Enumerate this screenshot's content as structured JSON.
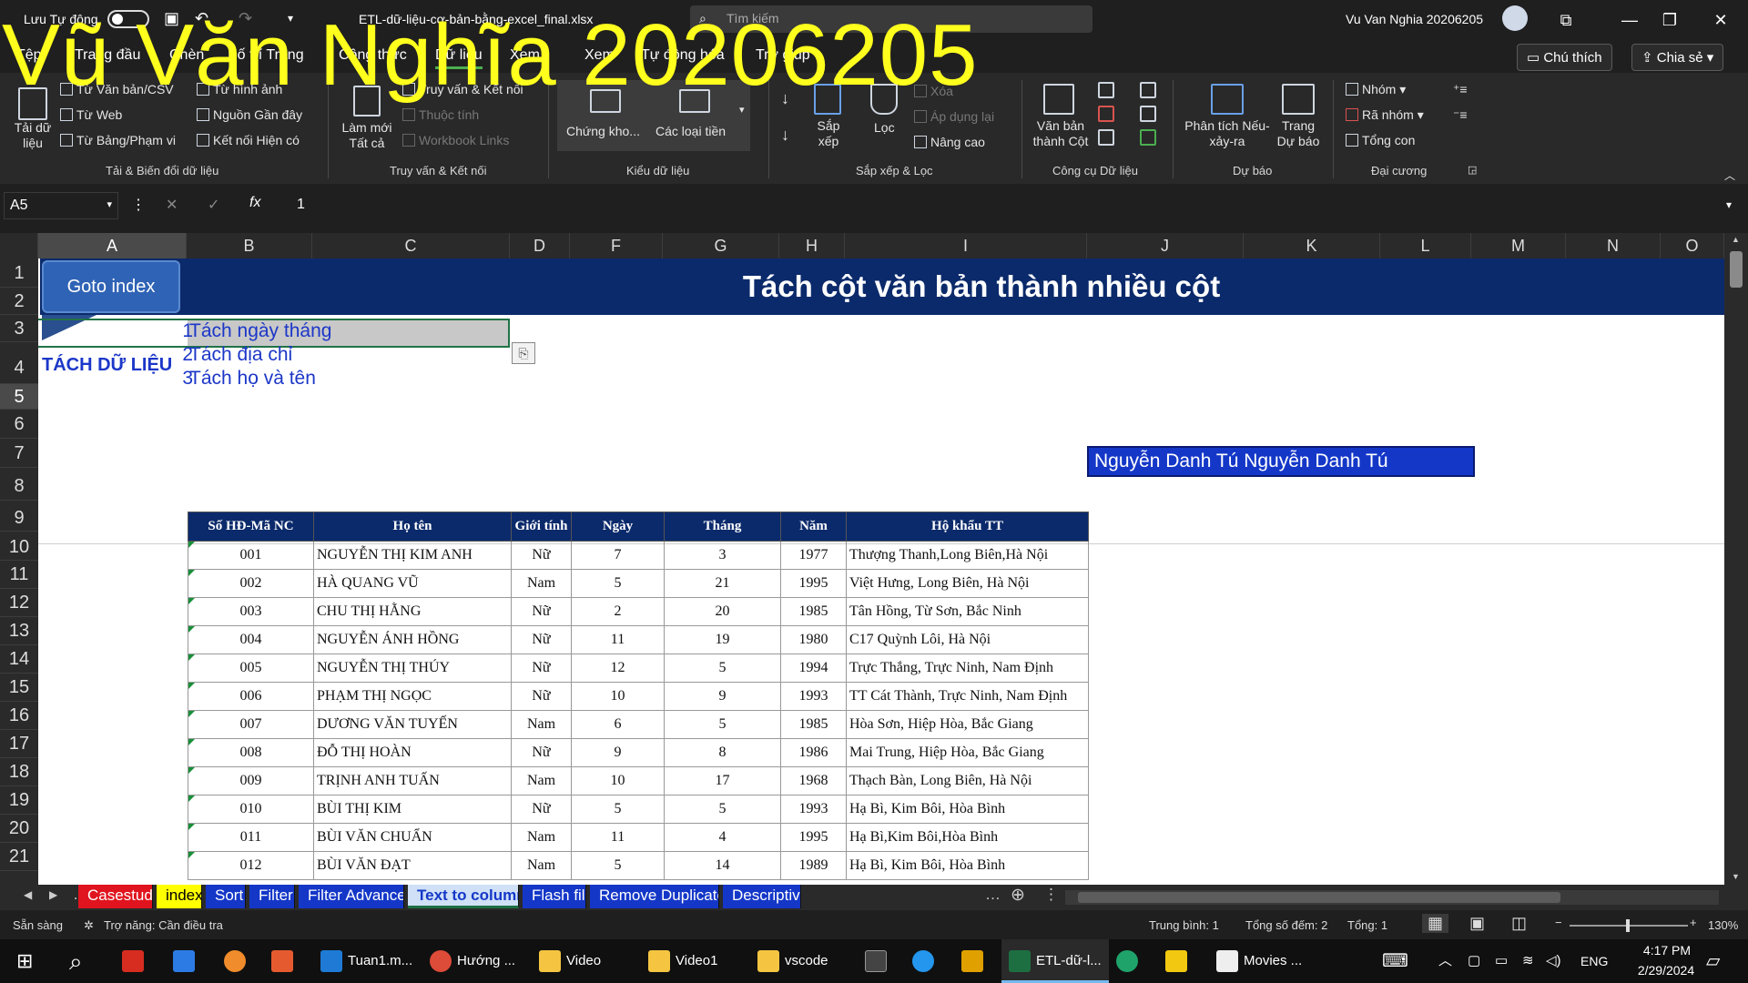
{
  "titlebar": {
    "autosave_label": "Lưu Tự động",
    "filename": "ETL-dữ-liệu-cơ-bản-bằng-excel_final.xlsx",
    "search_placeholder": "Tìm kiếm",
    "user_name": "Vu Van Nghia 20206205"
  },
  "watermark": "Vũ Văn Nghĩa 20206205",
  "tabs": [
    "Tệp",
    "Trang đầu",
    "Chèn",
    "Bố trí Trang",
    "Công thức",
    "Dữ liệu",
    "Xem",
    "Xem",
    "Tự động hóa",
    "Trợ giúp"
  ],
  "top_buttons": {
    "comments": "Chú thích",
    "share": "Chia sẻ"
  },
  "ribbon": {
    "get_data": "Tải dữ liệu",
    "from_text": "Từ Văn bản/CSV",
    "from_web": "Từ Web",
    "from_table": "Từ Bảng/Phạm vi",
    "from_picture": "Từ hình ảnh",
    "recent_sources": "Nguồn Gần đây",
    "existing_conn": "Kết nối Hiện có",
    "group_get": "Tải & Biến đổi dữ liệu",
    "refresh_all": "Làm mới Tất cả",
    "queries_conn": "Truy vấn & Kết nối",
    "properties": "Thuộc tính",
    "workbook_links": "Workbook Links",
    "group_queries": "Truy vấn & Kết nối",
    "stocks": "Chứng kho...",
    "data_types": "Các loại tiền",
    "group_types": "Kiểu dữ liệu",
    "sort": "Sắp xếp",
    "filter": "Lọc",
    "clear": "Xóa",
    "reapply": "Áp dụng lại",
    "advanced": "Nâng cao",
    "group_sort": "Sắp xếp & Lọc",
    "text_to_cols": "Văn bản thành Cột",
    "group_tools": "Công cụ Dữ liệu",
    "what_if": "Phân tích Nếu-xảy-ra",
    "forecast_sheet": "Trang Dự báo",
    "group_forecast": "Dự báo",
    "group": "Nhóm",
    "ungroup": "Rã nhóm",
    "subtotal": "Tổng con",
    "group_outline": "Đại cương"
  },
  "formula_bar": {
    "cell_ref": "A5",
    "fx": "fx",
    "value": "1"
  },
  "columns": [
    "A",
    "B",
    "C",
    "D",
    "F",
    "G",
    "H",
    "I",
    "J",
    "K",
    "L",
    "M",
    "N",
    "O"
  ],
  "rows": [
    "1",
    "2",
    "3",
    "4",
    "5",
    "6",
    "7",
    "8",
    "9",
    "10",
    "11",
    "12",
    "13",
    "14",
    "15",
    "16",
    "17",
    "18",
    "19",
    "20",
    "21"
  ],
  "sheet": {
    "goto_index": "Goto index",
    "banner_title": "Tách cột văn bản thành nhiều cột",
    "section_label": "TÁCH DỮ LIỆU",
    "items": [
      {
        "num": "1",
        "text": "Tách ngày tháng"
      },
      {
        "num": "2",
        "text": "Tách địa chỉ"
      },
      {
        "num": "3",
        "text": "Tách họ và tên"
      }
    ],
    "name_cell": "Nguyễn Danh Tú  Nguyễn Danh  Tú"
  },
  "table": {
    "headers": [
      "Số HĐ-Mã NC",
      "Họ tên",
      "Giới tính",
      "Ngày",
      "Tháng",
      "Năm",
      "Hộ khẩu TT"
    ],
    "rows": [
      [
        "001",
        "NGUYỄN THỊ KIM ANH",
        "Nữ",
        "7",
        "3",
        "1977",
        "Thượng Thanh,Long Biên,Hà Nội"
      ],
      [
        "002",
        "HÀ QUANG VŨ",
        "Nam",
        "5",
        "21",
        "1995",
        "Việt Hưng, Long Biên, Hà Nội"
      ],
      [
        "003",
        "CHU THỊ HẰNG",
        "Nữ",
        "2",
        "20",
        "1985",
        "Tân Hồng, Từ Sơn, Bắc Ninh"
      ],
      [
        "004",
        "NGUYỄN ÁNH HỒNG",
        "Nữ",
        "11",
        "19",
        "1980",
        "C17 Quỳnh Lôi, Hà Nội"
      ],
      [
        "005",
        "NGUYỄN THỊ THÚY",
        "Nữ",
        "12",
        "5",
        "1994",
        "Trực Thắng, Trực Ninh, Nam Định"
      ],
      [
        "006",
        "PHẠM THỊ NGỌC",
        "Nữ",
        "10",
        "9",
        "1993",
        "TT Cát Thành, Trực Ninh, Nam Định"
      ],
      [
        "007",
        "DƯƠNG VĂN TUYẾN",
        "Nam",
        "6",
        "5",
        "1985",
        "Hòa Sơn, Hiệp Hòa, Bắc Giang"
      ],
      [
        "008",
        "ĐỖ THỊ HOÀN",
        "Nữ",
        "9",
        "8",
        "1986",
        "Mai Trung, Hiệp Hòa, Bắc Giang"
      ],
      [
        "009",
        "TRỊNH ANH TUẤN",
        "Nam",
        "10",
        "17",
        "1968",
        "Thạch Bàn, Long Biên, Hà Nội"
      ],
      [
        "010",
        "BÙI THỊ KIM",
        "Nữ",
        "5",
        "5",
        "1993",
        "Hạ Bì, Kim Bôi, Hòa Bình"
      ],
      [
        "011",
        "BÙI VĂN CHUẨN",
        "Nam",
        "11",
        "4",
        "1995",
        "Hạ Bì,Kim Bôi,Hòa Bình"
      ],
      [
        "012",
        "BÙI VĂN ĐẠT",
        "Nam",
        "5",
        "14",
        "1989",
        "Hạ Bì, Kim Bôi, Hòa Bình"
      ]
    ]
  },
  "sheet_tabs": [
    {
      "label": "Casestudy",
      "color": "#e0141e",
      "text": "#ffffff"
    },
    {
      "label": "index",
      "color": "#ffff00",
      "text": "#000000"
    },
    {
      "label": "Sort",
      "color": "#1437c8",
      "text": "#ffffff"
    },
    {
      "label": "Filter",
      "color": "#1437c8",
      "text": "#ffffff"
    },
    {
      "label": "Filter Advanced",
      "color": "#1437c8",
      "text": "#ffffff"
    },
    {
      "label": "Text to columns",
      "color": "#cfe0f7",
      "text": "#1437c8"
    },
    {
      "label": "Flash fill",
      "color": "#1437c8",
      "text": "#ffffff"
    },
    {
      "label": "Remove Duplicates",
      "color": "#1437c8",
      "text": "#ffffff"
    },
    {
      "label": "Descriptive s",
      "color": "#1437c8",
      "text": "#ffffff"
    }
  ],
  "status": {
    "ready": "Sẵn sàng",
    "accessibility": "Trợ năng: Cần điều tra",
    "average": "Trung bình: 1",
    "count": "Tổng số đếm: 2",
    "sum": "Tổng: 1",
    "zoom": "130%"
  },
  "taskbar": {
    "apps": [
      "Tuan1.m...",
      "Hướng ...",
      "Video",
      "Video1",
      "vscode",
      "ETL-dữ-l...",
      "Movies ..."
    ],
    "lang": "ENG",
    "time": "4:17 PM",
    "date": "2/29/2024"
  }
}
